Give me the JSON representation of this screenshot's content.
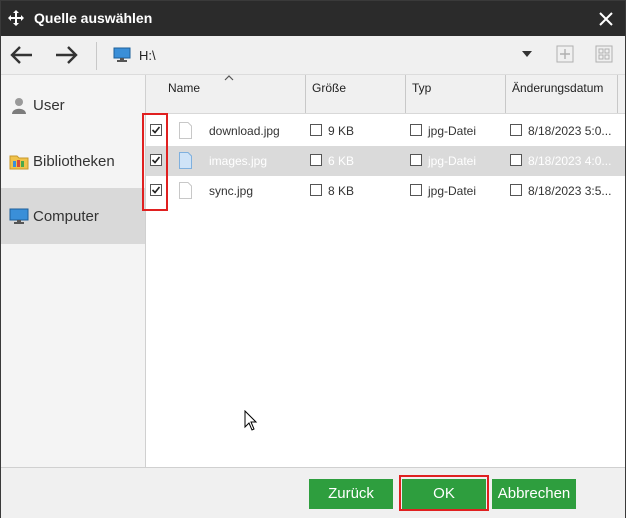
{
  "window": {
    "title": "Quelle auswählen"
  },
  "toolbar": {
    "path": "H:\\"
  },
  "sidebar": {
    "items": [
      {
        "label": "User",
        "icon": "user-icon"
      },
      {
        "label": "Bibliotheken",
        "icon": "library-folder-icon"
      },
      {
        "label": "Computer",
        "icon": "computer-icon",
        "active": true
      }
    ]
  },
  "table": {
    "columns": [
      "Name",
      "Größe",
      "Typ",
      "Änderungsdatum"
    ],
    "sorted_column": "Name",
    "rows": [
      {
        "name": "download.jpg",
        "size": "9 KB",
        "type": "jpg-Datei",
        "date": "8/18/2023 5:0...",
        "checked": true,
        "selected": false
      },
      {
        "name": "images.jpg",
        "size": "6 KB",
        "type": "jpg-Datei",
        "date": "8/18/2023 4:0...",
        "checked": true,
        "selected": true
      },
      {
        "name": "sync.jpg",
        "size": "8 KB",
        "type": "jpg-Datei",
        "date": "8/18/2023 3:5...",
        "checked": true,
        "selected": false
      }
    ]
  },
  "footer": {
    "back_label": "Zurück",
    "ok_label": "OK",
    "cancel_label": "Abbrechen"
  },
  "colors": {
    "titlebar": "#2b2b2b",
    "button_green": "#2e9e3e",
    "highlight_red": "#e02020",
    "selected_row": "#dadada"
  }
}
